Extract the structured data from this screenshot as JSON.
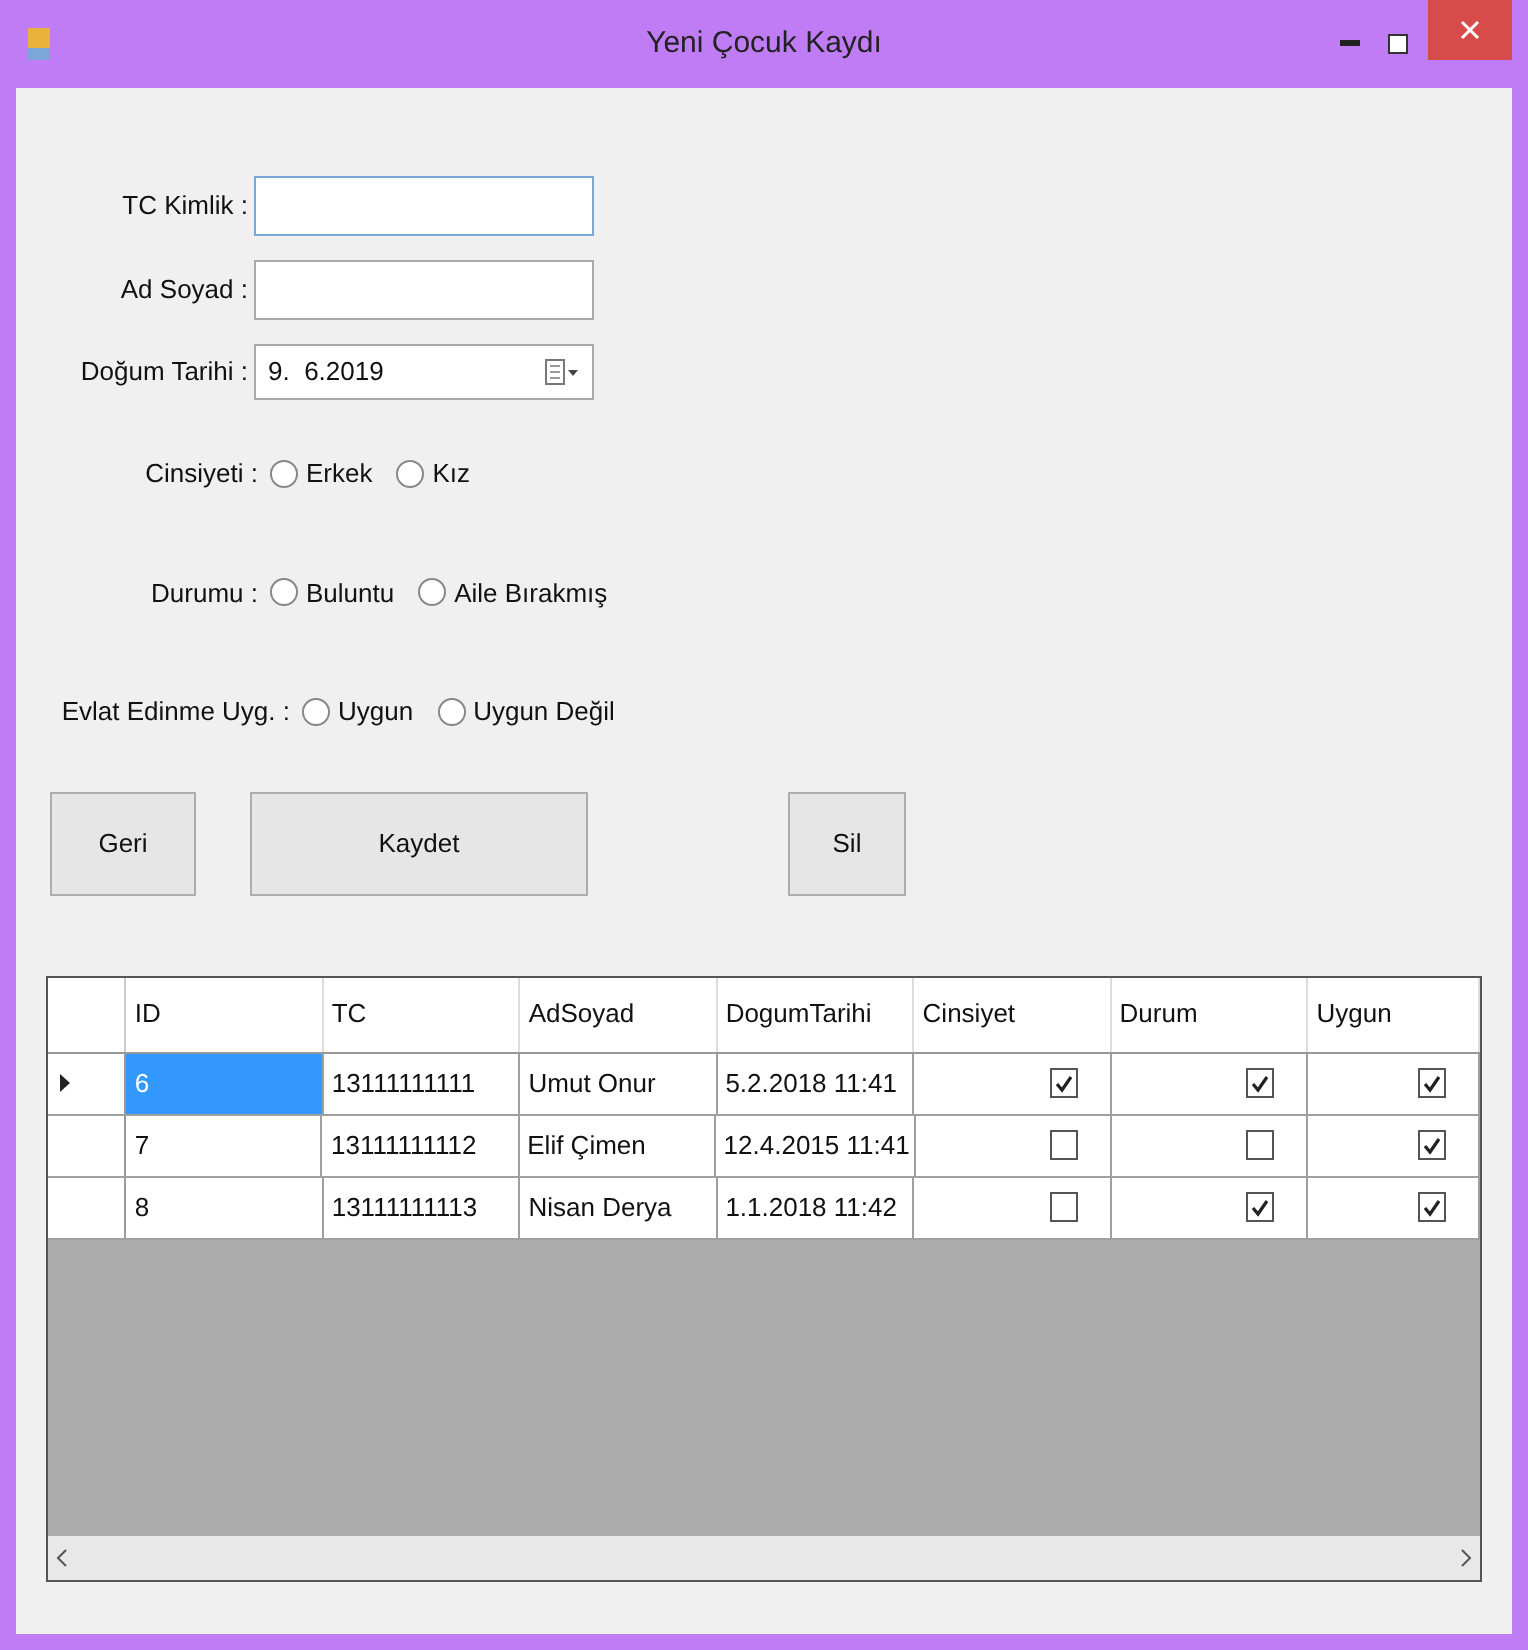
{
  "window": {
    "title": "Yeni Çocuk Kaydı"
  },
  "fields": [
    {
      "label": "TC Kimlik :",
      "focused": true
    },
    {
      "label": "Ad Soyad :",
      "focused": false
    }
  ],
  "date_field": {
    "label": "Doğum Tarihi :",
    "value": "9.  6.2019"
  },
  "radio_groups": [
    {
      "label": "Cinsiyeti :",
      "options": [
        {
          "label": "Erkek",
          "selected": false
        },
        {
          "label": "Kız",
          "selected": false
        }
      ]
    },
    {
      "label": "Durumu :",
      "options": [
        {
          "label": "Buluntu",
          "selected": false
        },
        {
          "label": "Aile Bırakmış",
          "selected": false
        }
      ]
    },
    {
      "label": "Evlat Edinme Uyg. :",
      "options": [
        {
          "label": "Uygun",
          "selected": false
        },
        {
          "label": "Uygun Değil",
          "selected": false
        }
      ]
    }
  ],
  "buttons": [
    "Geri",
    "Kaydet",
    "Sil"
  ],
  "table": {
    "columns": [
      "ID",
      "TC",
      "AdSoyad",
      "DogumTarihi",
      "Cinsiyet",
      "Durum",
      "Uygun"
    ],
    "rows": [
      {
        "current": true,
        "id": "6",
        "tc": "13111111111",
        "name": "Umut Onur",
        "date": "5.2.2018 11:41",
        "cinsiyet": true,
        "durum": true,
        "uygun": true
      },
      {
        "current": false,
        "id": "7",
        "tc": "13111111112",
        "name": "Elif Çimen",
        "date": "12.4.2015 11:41",
        "cinsiyet": false,
        "durum": false,
        "uygun": true
      },
      {
        "current": false,
        "id": "8",
        "tc": "13111111113",
        "name": "Nisan Derya",
        "date": "1.1.2018 11:42",
        "cinsiyet": false,
        "durum": true,
        "uygun": true
      }
    ]
  }
}
